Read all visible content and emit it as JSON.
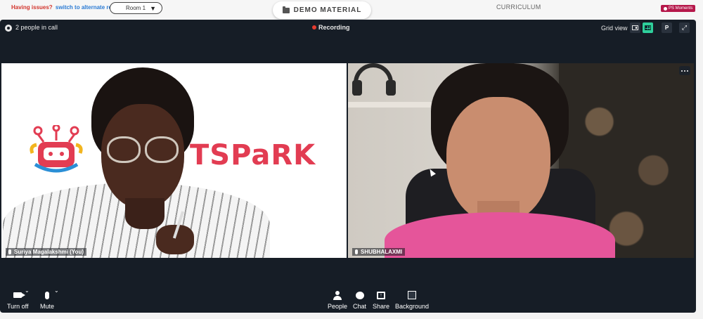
{
  "topbar": {
    "issues_label": "Having issues?",
    "alternate_link": "switch to alternate room",
    "room_value": "Room 1",
    "demo_material": "DEMO MATERIAL",
    "curriculum": "CURRICULUM",
    "moments": "PS Moments"
  },
  "call": {
    "people_count": "2 people in call",
    "recording": "Recording",
    "grid_view": "Grid view",
    "p_button": "P"
  },
  "tiles": [
    {
      "name": "Suriya Magalakshmi (You)",
      "logo_text": "TSPaRK"
    },
    {
      "name": "SHUBHALAXMI"
    }
  ],
  "controls": {
    "turn_off": "Turn off",
    "mute": "Mute",
    "people": "People",
    "chat": "Chat",
    "share": "Share",
    "background": "Background"
  }
}
